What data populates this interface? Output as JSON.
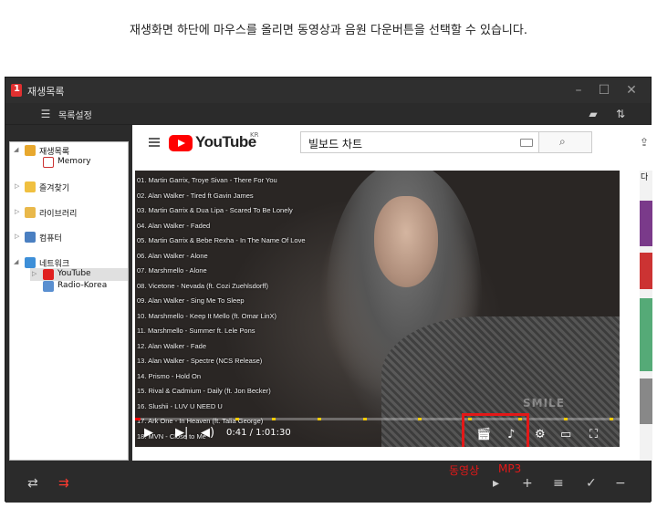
{
  "caption": "재생화면 하단에 마우스를 올리면 동영상과 음원 다운버튼을 선택할 수 있습니다.",
  "window": {
    "title": "재생목록"
  },
  "toolbar": {
    "settings_label": "목록설정"
  },
  "sidebar": {
    "items": [
      {
        "label": "재생목록"
      },
      {
        "label": "Memory"
      },
      {
        "label": "즐겨찾기"
      },
      {
        "label": "라이브러리"
      },
      {
        "label": "컴퓨터"
      },
      {
        "label": "네트워크"
      },
      {
        "label": "YouTube"
      },
      {
        "label": "Radio-Korea"
      }
    ]
  },
  "browser": {
    "logo_text": "YouTube",
    "country": "KR",
    "search_value": "빌보드 차트",
    "side_label": "다",
    "video": {
      "tracks": [
        "01. Martin Garrix, Troye Sivan - There For You",
        "02. Alan Walker - Tired ft Gavin James",
        "03. Martin Garrix & Dua Lipa - Scared To Be Lonely",
        "04. Alan Walker - Faded",
        "05. Martin Garrix & Bebe Rexha - In The Name Of Love",
        "06. Alan Walker - Alone",
        "07. Marshmello - Alone",
        "08. Vicetone - Nevada (ft. Cozi Zuehlsdorff)",
        "09. Alan Walker - Sing Me To Sleep",
        "10. Marshmello - Keep It Mello (ft. Omar LinX)",
        "11. Marshmello - Summer ft. Lele Pons",
        "12. Alan Walker - Fade",
        "13. Alan Walker - Spectre (NCS Release)",
        "14. Prismo - Hold On",
        "15. Rival & Cadmium - Daily (ft. Jon Becker)",
        "16. Slushii - LUV U NEED U",
        "17. Ark One - In Heaven (ft. Talia George)",
        "18. MVN - Close to Me"
      ],
      "watermark": "SMILE",
      "time": "0:41 / 1:01:30",
      "progress": 0.011
    }
  },
  "annotations": {
    "video": "동영상",
    "mp3": "MP3"
  },
  "colors": {
    "highlight": "#e31818",
    "youtube_red": "#ff0000",
    "app_bg": "#2b2b2b"
  }
}
